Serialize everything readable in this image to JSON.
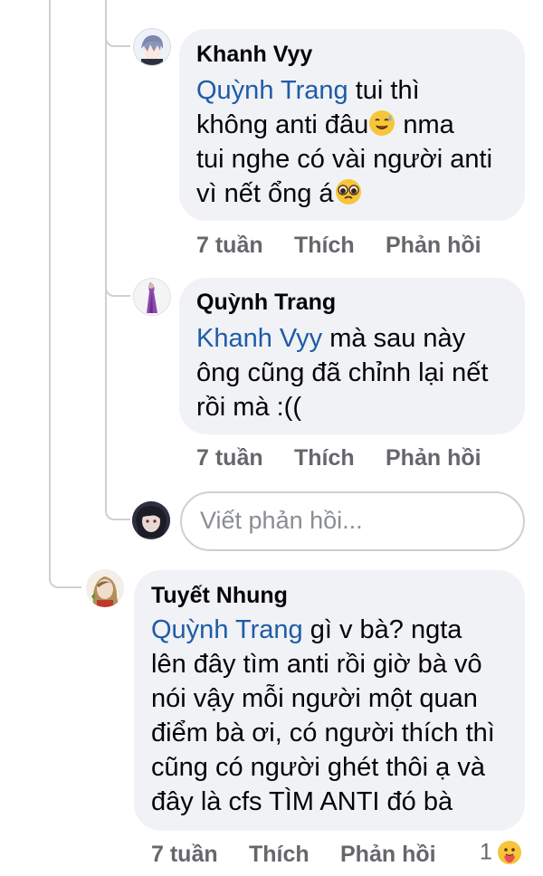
{
  "comments": [
    {
      "author": "Khanh Vyy",
      "mention": "Quỳnh Trang",
      "lines": [
        " tui thì",
        "không anti đâu",
        " nma",
        "tui nghe có vài người anti",
        "vì nết ổng á"
      ],
      "time": "7 tuần",
      "like": "Thích",
      "reply": "Phản hồi"
    },
    {
      "author": "Quỳnh Trang",
      "mention": "Khanh Vyy",
      "lines": [
        " mà sau này",
        "ông cũng đã chỉnh lại nết",
        "rồi mà :(("
      ],
      "time": "7 tuần",
      "like": "Thích",
      "reply": "Phản hồi"
    },
    {
      "author": "Tuyết Nhung",
      "mention": "Quỳnh Trang",
      "lines": [
        " gì v bà? ngta",
        "lên đây tìm anti rồi giờ bà vô",
        "nói vậy mỗi người một quan",
        "điểm bà ơi, có người thích thì",
        "cũng có người ghét thôi ạ và",
        "đây là cfs TÌM ANTI đó bà"
      ],
      "time": "7 tuần",
      "like": "Thích",
      "reply": "Phản hồi",
      "reaction_count": "1"
    }
  ],
  "reply_input": {
    "placeholder": "Viết phản hồi..."
  },
  "icons": {
    "emoji_1": "sweat-smile-emoji-icon",
    "emoji_2": "pleading-face-emoji-icon",
    "reaction": "care-reaction-icon"
  }
}
